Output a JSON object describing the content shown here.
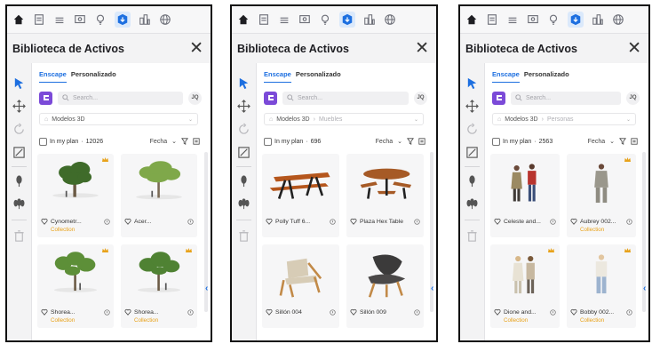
{
  "colors": {
    "accent": "#1d6fe0",
    "collection": "#e8a21a",
    "brand": "#7b4ad8"
  },
  "panels": [
    {
      "title": "Biblioteca de Activos",
      "tabs": [
        "Enscape",
        "Personalizado"
      ],
      "search_placeholder": "Search...",
      "user_initials": "JQ",
      "breadcrumb": {
        "root": "Modelos 3D",
        "sub": ""
      },
      "filter": {
        "label": "In my plan",
        "count": "12026",
        "sort": "Fecha"
      },
      "assets": [
        {
          "name": "Cynometr...",
          "tag": "Collection",
          "kind": "tree-a"
        },
        {
          "name": "Acer...",
          "tag": "",
          "kind": "tree-b"
        },
        {
          "name": "Shorea...",
          "tag": "Collection",
          "kind": "tree-c"
        },
        {
          "name": "Shorea...",
          "tag": "Collection",
          "kind": "tree-d"
        }
      ]
    },
    {
      "title": "Biblioteca de Activos",
      "tabs": [
        "Enscape",
        "Personalizado"
      ],
      "search_placeholder": "Search...",
      "user_initials": "JQ",
      "breadcrumb": {
        "root": "Modelos 3D",
        "sub": "Muebles"
      },
      "filter": {
        "label": "In my plan",
        "count": "696",
        "sort": "Fecha"
      },
      "assets": [
        {
          "name": "Polly Tuff 6...",
          "tag": "",
          "kind": "picnic"
        },
        {
          "name": "Plaza Hex Table",
          "tag": "",
          "kind": "hex"
        },
        {
          "name": "Sillón 004",
          "tag": "",
          "kind": "chair-a"
        },
        {
          "name": "Sillón 009",
          "tag": "",
          "kind": "chair-b"
        }
      ]
    },
    {
      "title": "Biblioteca de Activos",
      "tabs": [
        "Enscape",
        "Personalizado"
      ],
      "search_placeholder": "Search...",
      "user_initials": "JQ",
      "breadcrumb": {
        "root": "Modelos 3D",
        "sub": "Personas"
      },
      "filter": {
        "label": "In my plan",
        "count": "2563",
        "sort": "Fecha"
      },
      "assets": [
        {
          "name": "Celeste and...",
          "tag": "",
          "kind": "people-a"
        },
        {
          "name": "Aubrey 002...",
          "tag": "Collection",
          "kind": "person-b"
        },
        {
          "name": "Dione and...",
          "tag": "Collection",
          "kind": "people-c"
        },
        {
          "name": "Bobby 002...",
          "tag": "Collection",
          "kind": "person-d"
        }
      ]
    }
  ]
}
